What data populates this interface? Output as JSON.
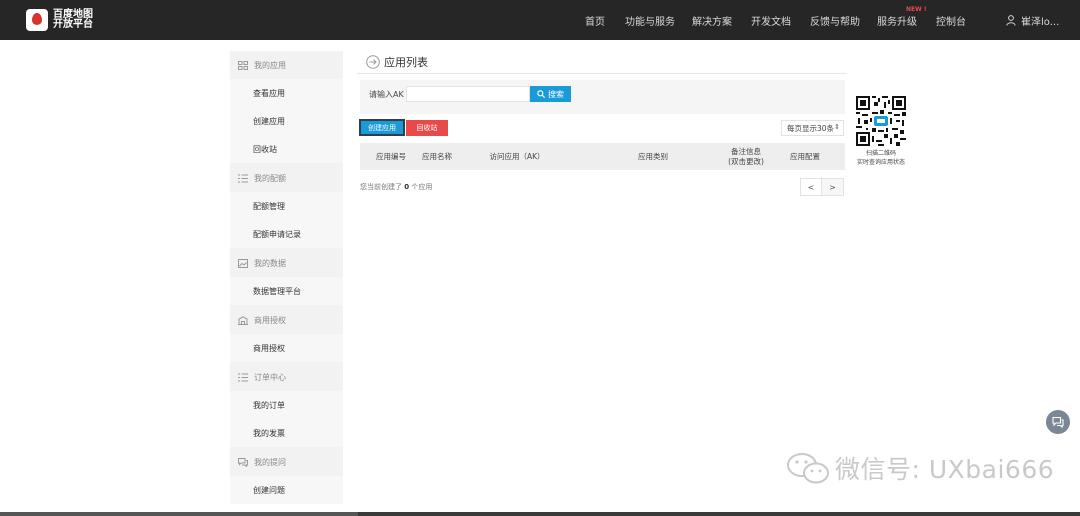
{
  "brand": {
    "line1": "百度地图",
    "line2": "开放平台"
  },
  "nav": {
    "items": [
      "首页",
      "功能与服务",
      "解决方案",
      "开发文档",
      "反馈与帮助",
      "服务升级",
      "控制台"
    ],
    "new_badge": "NEW !",
    "user": "崔泽lo..."
  },
  "sidebar": {
    "sections": [
      {
        "label": "我的应用",
        "icon": "grid-icon",
        "items": [
          "查看应用",
          "创建应用",
          "回收站"
        ]
      },
      {
        "label": "我的配额",
        "icon": "list-icon",
        "items": [
          "配额管理",
          "配额申请记录"
        ]
      },
      {
        "label": "我的数据",
        "icon": "image-icon",
        "items": [
          "数据管理平台"
        ]
      },
      {
        "label": "商用授权",
        "icon": "building-icon",
        "items": [
          "商用授权"
        ]
      },
      {
        "label": "订单中心",
        "icon": "list-icon",
        "items": [
          "我的订单",
          "我的发票"
        ]
      },
      {
        "label": "我的提问",
        "icon": "chat-icon",
        "items": [
          "创建问题"
        ]
      }
    ]
  },
  "main": {
    "title": "应用列表",
    "search": {
      "label": "请输入AK",
      "placeholder": "",
      "button": "搜索"
    },
    "create_button": "创建应用",
    "recycle_button": "回收站",
    "per_page": "每页显示30条",
    "columns": [
      "应用编号",
      "应用名称",
      "访问应用（AK）",
      "应用类别",
      "备注信息\n(双击更改)",
      "应用配置"
    ],
    "summary_prefix": "您当前创建了",
    "summary_count": "0",
    "summary_suffix": "个应用",
    "pager": {
      "prev": "<",
      "next": ">"
    }
  },
  "qr": {
    "line1": "扫描二维码",
    "line2": "实时查询应用状态"
  },
  "watermark": "微信号: UXbai666"
}
